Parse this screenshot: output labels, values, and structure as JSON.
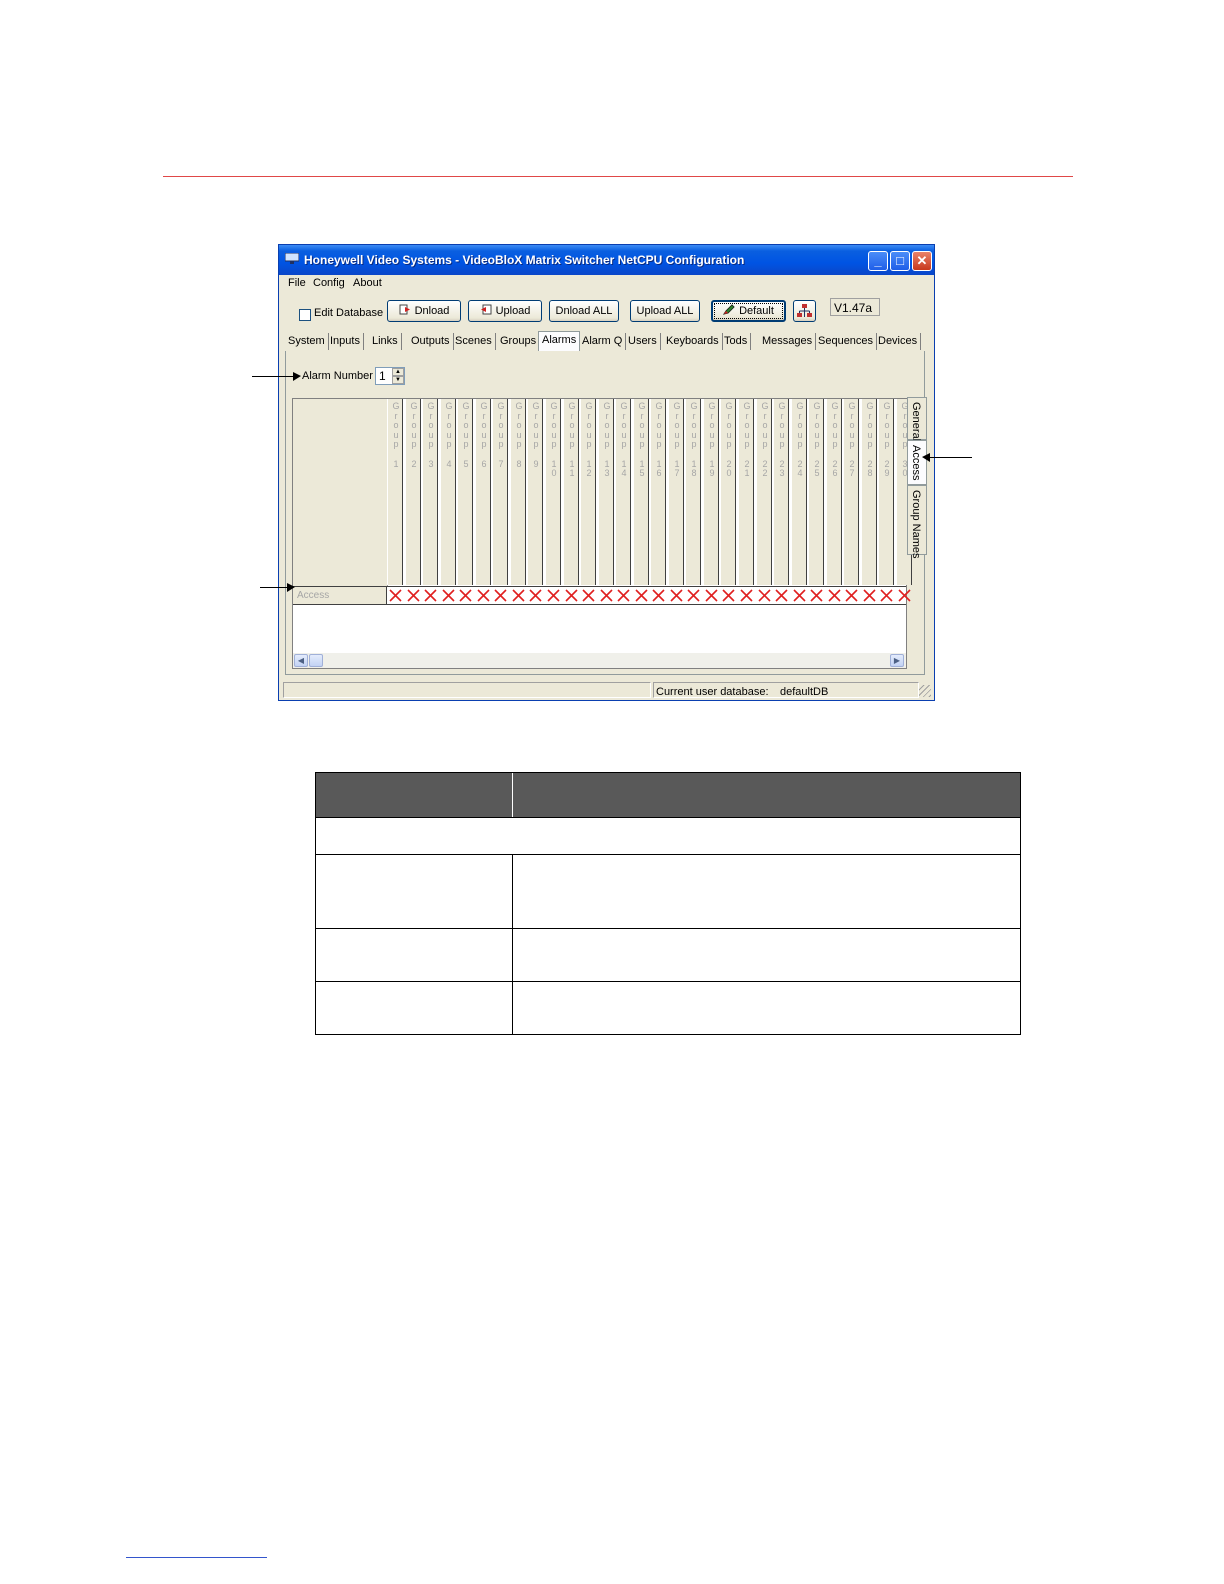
{
  "colors": {
    "rule": "#e04848",
    "titlebar": "#0054e3",
    "x_mark": "#e02020",
    "table_header": "#595959"
  },
  "window": {
    "title": "Honeywell Video Systems - VideoBloX Matrix Switcher NetCPU Configuration",
    "menu": [
      "File",
      "Config",
      "About"
    ],
    "toolbar": {
      "edit_database_label": "Edit Database",
      "edit_database_checked": false,
      "buttons": [
        "Dnload",
        "Upload",
        "Dnload ALL",
        "Upload ALL",
        "Default"
      ],
      "version": "V1.47a"
    },
    "tabs": [
      "System",
      "Inputs",
      "Links",
      "Outputs",
      "Scenes",
      "Groups",
      "Alarms",
      "Alarm Q",
      "Users",
      "Keyboards",
      "Tods",
      "Messages",
      "Sequences",
      "Devices"
    ],
    "active_tab": "Alarms",
    "alarm_number_label": "Alarm Number",
    "alarm_number_value": "1",
    "side_tabs": [
      "General",
      "Access",
      "Group Names"
    ],
    "active_side_tab": "Access",
    "grid": {
      "group_headers": [
        "Group 1",
        "Group 2",
        "Group 3",
        "Group 4",
        "Group 5",
        "Group 6",
        "Group 7",
        "Group 8",
        "Group 9",
        "Group 10",
        "Group 11",
        "Group 12",
        "Group 13",
        "Group 14",
        "Group 15",
        "Group 16",
        "Group 17",
        "Group 18",
        "Group 19",
        "Group 20",
        "Group 21",
        "Group 22",
        "Group 23",
        "Group 24",
        "Group 25",
        "Group 26",
        "Group 27",
        "Group 28",
        "Group 29",
        "Group 30"
      ],
      "row_label": "Access",
      "row_values": "all X (no access)"
    },
    "status": {
      "db_label": "Current user database:",
      "db_value": "defaultDB"
    }
  }
}
